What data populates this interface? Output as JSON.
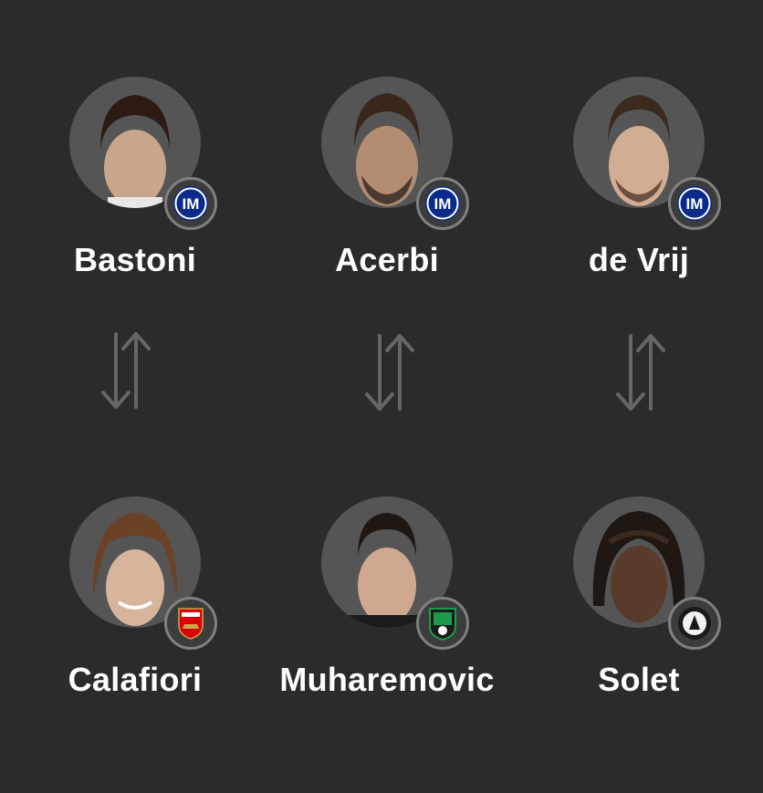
{
  "colors": {
    "background": "#2b2b2b",
    "avatar_bg": "#555555",
    "badge_ring": "#808080",
    "swap_arrow": "#666666"
  },
  "players_out": [
    {
      "name": "Bastoni",
      "club": "inter-crest-icon"
    },
    {
      "name": "Acerbi",
      "club": "inter-crest-icon"
    },
    {
      "name": "de Vrij",
      "club": "inter-crest-icon"
    }
  ],
  "players_in": [
    {
      "name": "Calafiori",
      "club": "arsenal-crest-icon"
    },
    {
      "name": "Muharemovic",
      "club": "sassuolo-crest-icon"
    },
    {
      "name": "Solet",
      "club": "udinese-crest-icon"
    }
  ],
  "swap_icon": "swap-arrows-icon"
}
